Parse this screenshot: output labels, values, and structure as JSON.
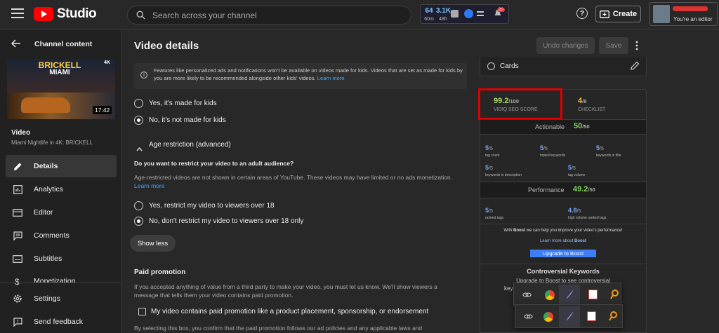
{
  "topbar": {
    "logo_text": "Studio",
    "search_placeholder": "Search across your channel",
    "ext_stats": [
      {
        "value": "64",
        "label": "60m"
      },
      {
        "value": "3.1K",
        "label": "48h"
      }
    ],
    "notif_count": "20",
    "create_label": "Create",
    "account_role": "You're an editor"
  },
  "sidebar": {
    "back_title": "Channel content",
    "thumb_title_line1": "BRICKELL",
    "thumb_title_line2": "MIAMI",
    "thumb_badge": "4K",
    "duration": "17:42",
    "video_label": "Video",
    "video_name": "Miami Nightlife in 4K: BRICKELL",
    "items": [
      {
        "label": "Details",
        "icon": "pencil-icon"
      },
      {
        "label": "Analytics",
        "icon": "analytics-icon"
      },
      {
        "label": "Editor",
        "icon": "editor-icon"
      },
      {
        "label": "Comments",
        "icon": "comments-icon"
      },
      {
        "label": "Subtitles",
        "icon": "subtitles-icon"
      },
      {
        "label": "Monetization",
        "icon": "monetization-icon"
      }
    ],
    "settings_label": "Settings",
    "feedback_label": "Send feedback"
  },
  "main": {
    "title": "Video details",
    "undo_label": "Undo changes",
    "save_label": "Save",
    "kids_notice": "Features like personalized ads and notifications won't be available on videos made for kids. Videos that are set as made for kids by you are more likely to be recommended alongside other kids' videos.",
    "kids_notice_link": "Learn more",
    "kids_yes": "Yes, it's made for kids",
    "kids_no": "No, it's not made for kids",
    "age_header": "Age restriction (advanced)",
    "age_question": "Do you want to restrict your video to an adult audience?",
    "age_desc": "Age-restricted videos are not shown in certain areas of YouTube. These videos may have limited or no ads monetization.",
    "age_learn": "Learn more",
    "age_yes": "Yes, restrict my video to viewers over 18",
    "age_no": "No, don't restrict my video to viewers over 18 only",
    "show_less": "Show less",
    "paid_title": "Paid promotion",
    "paid_desc": "If you accepted anything of value from a third party to make your video, you must let us know. We'll show viewers a message that tells them your video contains paid promotion.",
    "paid_checkbox": "My video contains paid promotion like a product placement, sponsorship, or endorsement",
    "paid_footer": "By selecting this box, you confirm that the paid promotion follows our ad policies and any applicable laws and"
  },
  "right": {
    "cards_label": "Cards",
    "seo_score": "99.2",
    "seo_max": "/100",
    "seo_label": "VIDIQ SEO SCORE",
    "checklist_score": "4",
    "checklist_max": "/8",
    "checklist_label": "CHECKLIST",
    "actionable_label": "Actionable",
    "actionable_score": "50",
    "actionable_max": "/50",
    "metrics": [
      {
        "value": "5",
        "max": "/5",
        "label": "tag count"
      },
      {
        "value": "5",
        "max": "/5",
        "label": "tripled keywords"
      },
      {
        "value": "5",
        "max": "/5",
        "label": "keywords in title"
      },
      {
        "value": "5",
        "max": "/5",
        "label": "keywords in description"
      },
      {
        "value": "5",
        "max": "/5",
        "label": "tag volume"
      }
    ],
    "performance_label": "Performance",
    "performance_score": "49.2",
    "performance_max": "/50",
    "perf_metrics": [
      {
        "value": "5",
        "max": "/5",
        "label": "ranked tags"
      },
      {
        "value": "4.8",
        "max": "/5",
        "label": "high volume ranked tags"
      }
    ],
    "boost_prefix": "With ",
    "boost_word": "Boost",
    "boost_suffix": " we can help you improve your video's performance!",
    "boost_learn": "Learn more about ",
    "boost_learn_bold": "Boost",
    "upgrade_label": "Upgrade to Boost",
    "controversial_title": "Controversial Keywords",
    "controversial_desc": "Upgrade to Boost to see controversial",
    "controversial_desc2": "keyw"
  },
  "colors": {
    "seo_green": "#a6d96a",
    "checklist_yellow": "#f4c542",
    "score_green": "#7ed957",
    "metric_blue": "#6fa8ff",
    "upgrade_blue": "#3d7ef5",
    "highlight_red": "#e00000"
  }
}
